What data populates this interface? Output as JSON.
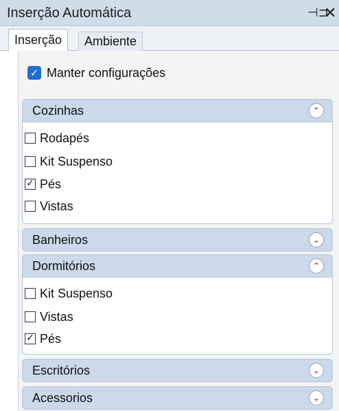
{
  "panel": {
    "title": "Inserção Automática",
    "pin_glyph": "⊣⊐",
    "close_glyph": "✕"
  },
  "tabs": [
    {
      "label": "Inserção",
      "active": true
    },
    {
      "label": "Ambiente",
      "active": false
    }
  ],
  "keep_settings": {
    "label": "Manter configurações",
    "checked": true,
    "check_glyph": "✓"
  },
  "icons": {
    "expand": "⌃",
    "collapse": "⌄",
    "check": "✓"
  },
  "sections": {
    "cozinhas": {
      "title": "Cozinhas",
      "expanded": true,
      "chevron": "⌃",
      "items": [
        {
          "label": "Rodapés",
          "checked": false
        },
        {
          "label": "Kit Suspenso",
          "checked": false
        },
        {
          "label": "Pés",
          "checked": true,
          "mark": "✓"
        },
        {
          "label": "Vistas",
          "checked": false
        }
      ]
    },
    "banheiros": {
      "title": "Banheiros",
      "expanded": false,
      "chevron": "⌄"
    },
    "dormitorios": {
      "title": "Dormitórios",
      "expanded": true,
      "chevron": "⌃",
      "items": [
        {
          "label": "Kit Suspenso",
          "checked": false
        },
        {
          "label": "Vistas",
          "checked": false
        },
        {
          "label": "Pés",
          "checked": true,
          "mark": "✓"
        }
      ]
    },
    "escritorios": {
      "title": "Escritórios",
      "expanded": false,
      "chevron": "⌄"
    },
    "acessorios": {
      "title": "Acessorios",
      "expanded": false,
      "chevron": "⌄"
    }
  },
  "colors": {
    "header_bg": "#cbd9ea",
    "title_bar_bg": "#cfdcea",
    "accent_checkbox": "#1e6fd0"
  }
}
